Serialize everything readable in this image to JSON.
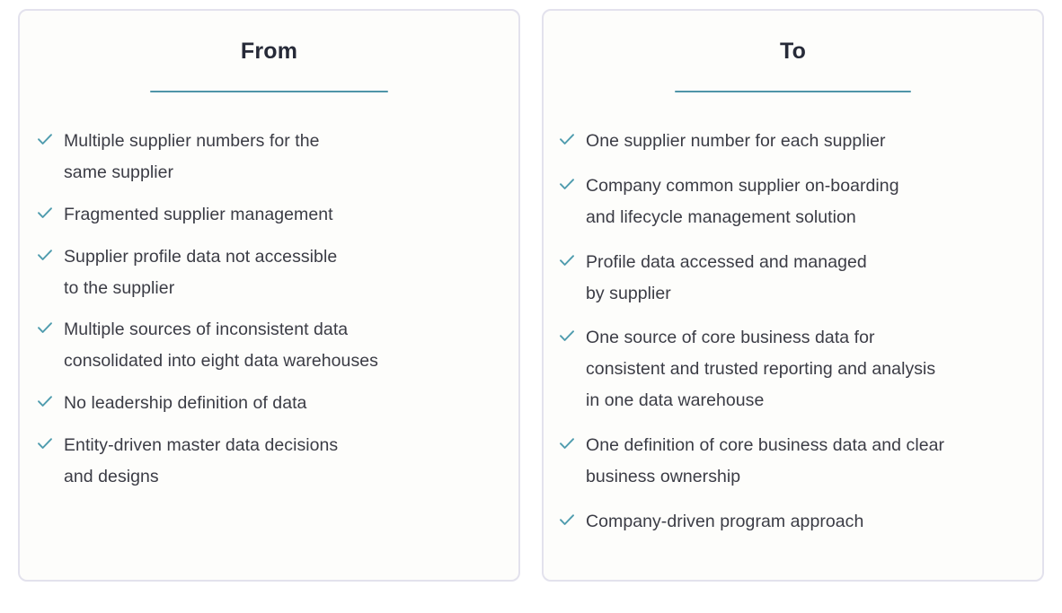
{
  "theme": {
    "page_background": "#ffffff",
    "card_background": "#fdfdfb",
    "card_border": "#e3e2ed",
    "title_color": "#262a38",
    "rule_color": "#4f95a8",
    "check_color": "#4f9cae",
    "body_text_color": "#3b3c45"
  },
  "panels": [
    {
      "id": "from",
      "title": "From",
      "check_icon": "check-icon",
      "items": [
        "Multiple supplier numbers for the\nsame supplier",
        "Fragmented supplier management",
        "Supplier profile data not accessible\nto the supplier",
        "Multiple sources of inconsistent data\nconsolidated into eight data warehouses",
        "No leadership definition of data",
        "Entity-driven master data decisions\nand designs"
      ]
    },
    {
      "id": "to",
      "title": "To",
      "check_icon": "check-icon",
      "items": [
        "One supplier number for each supplier",
        "Company common supplier on-boarding\nand lifecycle management solution",
        "Profile data accessed and managed\nby supplier",
        "One source of core business data for\nconsistent and trusted reporting and analysis\nin one data warehouse",
        "One definition of core business data and clear\nbusiness ownership",
        "Company-driven program approach"
      ]
    }
  ]
}
